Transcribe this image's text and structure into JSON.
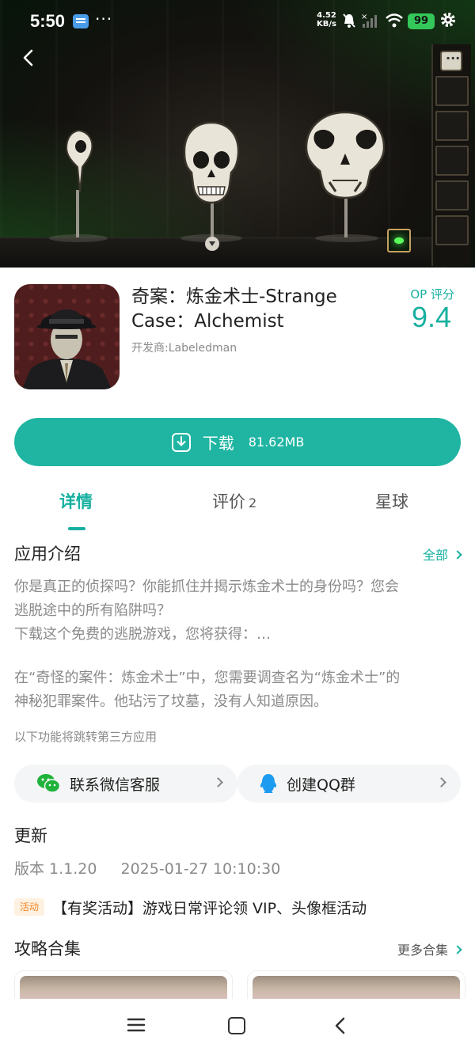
{
  "status_bar": {
    "time": "5:50",
    "more": "···",
    "net_speed_value": "4.52",
    "net_speed_unit": "KB/s",
    "battery": "99"
  },
  "banner": {
    "back_icon": "chevron-left-icon",
    "theme_colors": {
      "background": "#14120f",
      "glow": "#2e7a2e",
      "bone": "#e9e4d8"
    }
  },
  "app": {
    "name": "奇案：炼金术士-Strange Case：Alchemist",
    "developer": "开发商:Labeledman",
    "score_label": "OP 评分",
    "score": "9.4"
  },
  "download": {
    "label": "下载",
    "size": "81.62MB",
    "color": "#1fb5a2"
  },
  "tabs": [
    {
      "label": "详情",
      "count": "",
      "active": true
    },
    {
      "label": "评价",
      "count": "2",
      "active": false
    },
    {
      "label": "星球",
      "count": "",
      "active": false
    }
  ],
  "intro": {
    "title": "应用介绍",
    "more": "全部",
    "paragraph1_line1": "你是真正的侦探吗？你能抓住并揭示炼金术士的身份吗？您会",
    "paragraph1_line2": "逃脱途中的所有陷阱吗？",
    "paragraph1_line3": "下载这个免费的逃脱游戏，您将获得：…",
    "paragraph2_line1": "在“奇怪的案件：炼金术士”中，您需要调查名为“炼金术士”的",
    "paragraph2_line2": "神秘犯罪案件。他玷污了坟墓，没有人知道原因。",
    "third_party_note": "以下功能将跳转第三方应用"
  },
  "contacts": [
    {
      "label": "联系微信客服",
      "icon": "wechat-icon"
    },
    {
      "label": "创建QQ群",
      "icon": "qq-icon"
    }
  ],
  "update": {
    "title": "更新",
    "version": "版本 1.1.20",
    "date": "2025-01-27 10:10:30"
  },
  "event": {
    "badge": "活动",
    "text": "【有奖活动】游戏日常评论领 VIP、头像框活动"
  },
  "guides": {
    "title": "攻略合集",
    "more": "更多合集"
  },
  "accent_color": "#17b0a0"
}
